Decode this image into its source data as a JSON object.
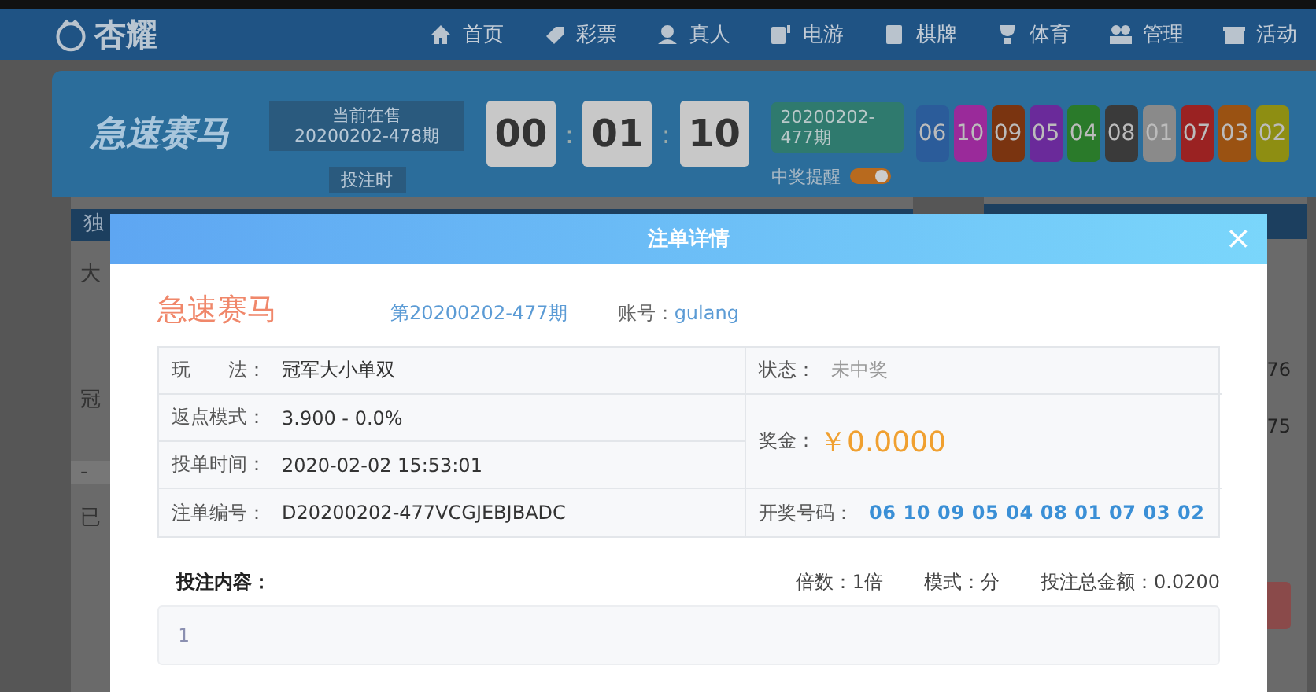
{
  "header": {
    "logo": "杏耀",
    "nav": [
      {
        "label": "首页"
      },
      {
        "label": "彩票"
      },
      {
        "label": "真人"
      },
      {
        "label": "电游"
      },
      {
        "label": "棋牌"
      },
      {
        "label": "体育"
      },
      {
        "label": "管理"
      },
      {
        "label": "活动"
      }
    ]
  },
  "lottery_bar": {
    "game": "急速赛马",
    "current_label": "当前在售",
    "current_period": "20200202-478期",
    "bet_tab": "投注时",
    "countdown": [
      "00",
      "01",
      "10"
    ],
    "separator": ":",
    "last_period": "20200202-477期",
    "balls": [
      {
        "number": "06",
        "color": "#2b5c9a"
      },
      {
        "number": "10",
        "color": "#9a2a9a"
      },
      {
        "number": "09",
        "color": "#7a3410"
      },
      {
        "number": "05",
        "color": "#6a2a9a"
      },
      {
        "number": "04",
        "color": "#2a7a2a"
      },
      {
        "number": "08",
        "color": "#3a3a3a"
      },
      {
        "number": "01",
        "color": "#8a8a8a"
      },
      {
        "number": "07",
        "color": "#9a2222"
      },
      {
        "number": "03",
        "color": "#9a5212"
      },
      {
        "number": "02",
        "color": "#8e8e12"
      }
    ],
    "reminder_label": "中奖提醒",
    "reminder_on": true
  },
  "left_panel": {
    "header": "独",
    "rows": [
      "大",
      "冠",
      "-",
      "已"
    ]
  },
  "right_panel": {
    "values": [
      "76",
      "75"
    ]
  },
  "modal": {
    "title": "注单详情",
    "close": "×",
    "game": "急速赛马",
    "period": "第20200202-477期",
    "account_label": "账号：",
    "account": "gulang",
    "details": {
      "play_label": "玩　　法：",
      "play": "冠军大小单双",
      "rebate_label": "返点模式：",
      "rebate": "3.900 - 0.0%",
      "time_label": "投单时间：",
      "time": "2020-02-02 15:53:01",
      "order_label": "注单编号：",
      "order": "D20200202-477VCGJEBJBADC",
      "status_label": "状态：",
      "status": "未中奖",
      "prize_label": "奖金：",
      "prize": "￥0.0000",
      "result_label": "开奖号码：",
      "result": "06 10 09 05 04 08 01 07 03 02"
    },
    "content_label": "投注内容：",
    "multiplier": "倍数：1倍",
    "mode": "模式：分",
    "total": "投注总金额：0.0200",
    "content": "1"
  }
}
